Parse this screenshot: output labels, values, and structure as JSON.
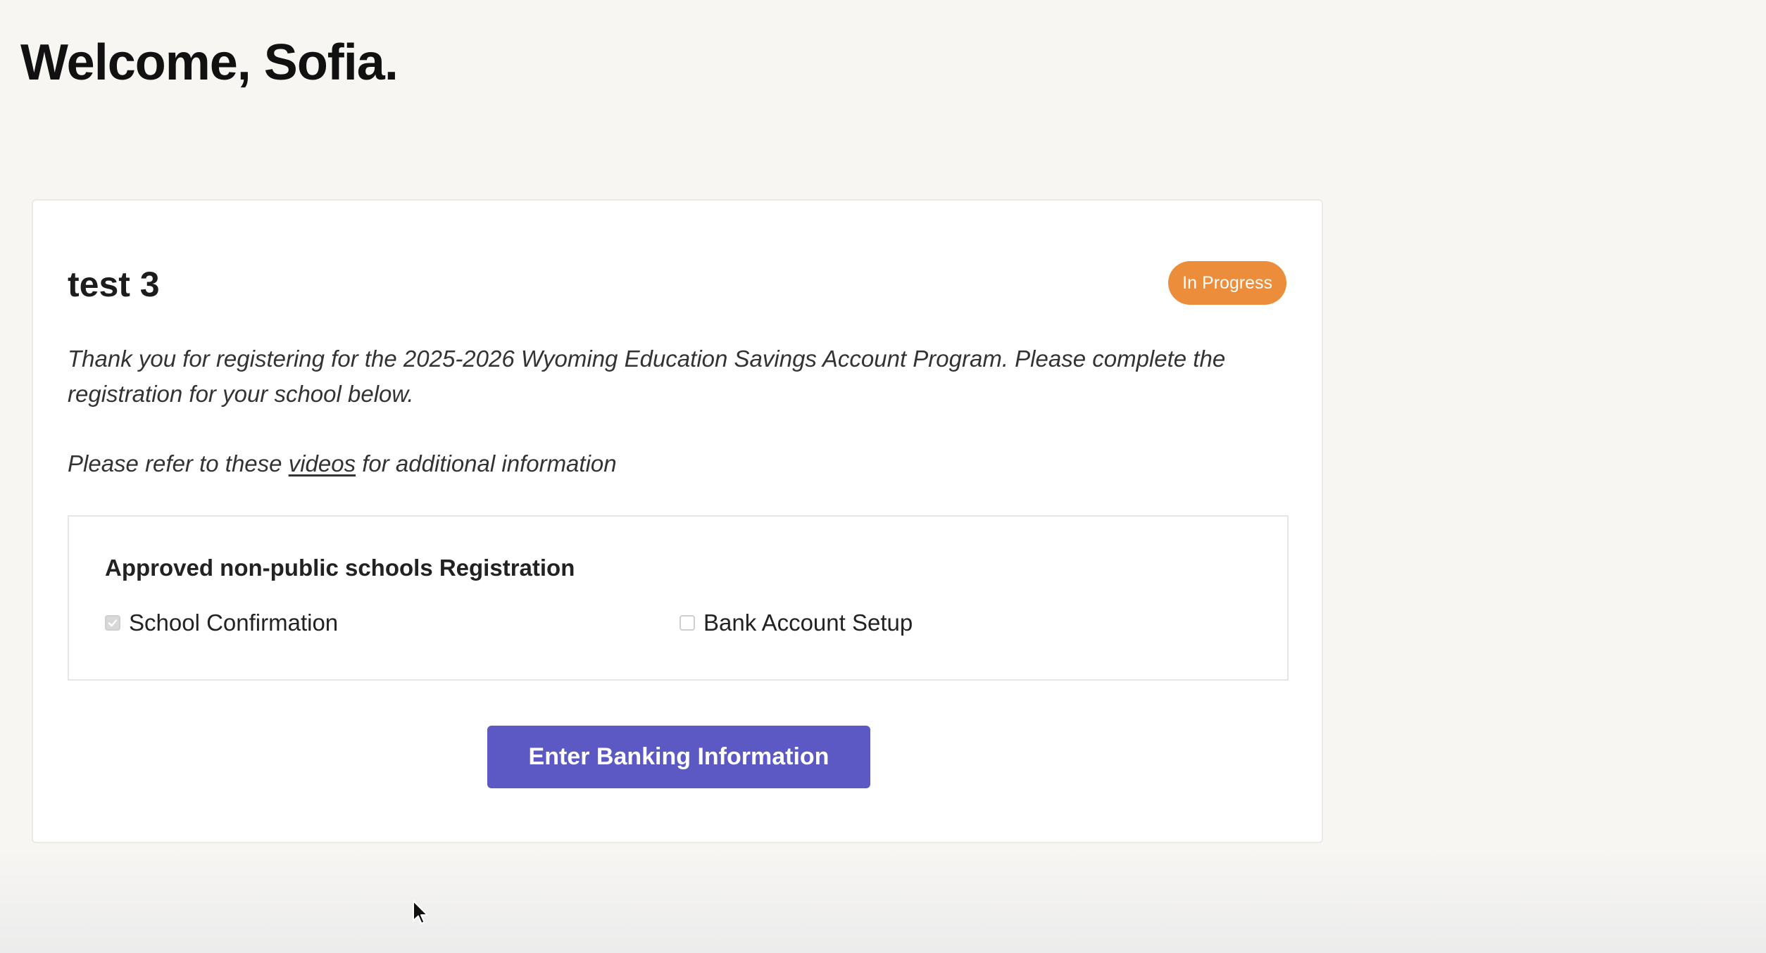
{
  "header": {
    "greeting": "Welcome, Sofia."
  },
  "card": {
    "title": "test 3",
    "status_badge": "In Progress",
    "intro_text": "Thank you for registering for the 2025-2026 Wyoming Education Savings Account Program. Please complete the registration for your school below.",
    "refer_prefix": "Please refer to these ",
    "refer_link": "videos",
    "refer_suffix": " for additional information"
  },
  "registration": {
    "heading": "Approved non-public schools Registration",
    "items": [
      {
        "label": "School Confirmation",
        "checked": true
      },
      {
        "label": "Bank Account Setup",
        "checked": false
      }
    ]
  },
  "actions": {
    "primary_label": "Enter Banking Information"
  },
  "colors": {
    "badge": "#ec8d3b",
    "primary_button": "#5c58c4"
  },
  "icons": {
    "check": "check-icon",
    "cursor": "mouse-pointer-icon"
  }
}
